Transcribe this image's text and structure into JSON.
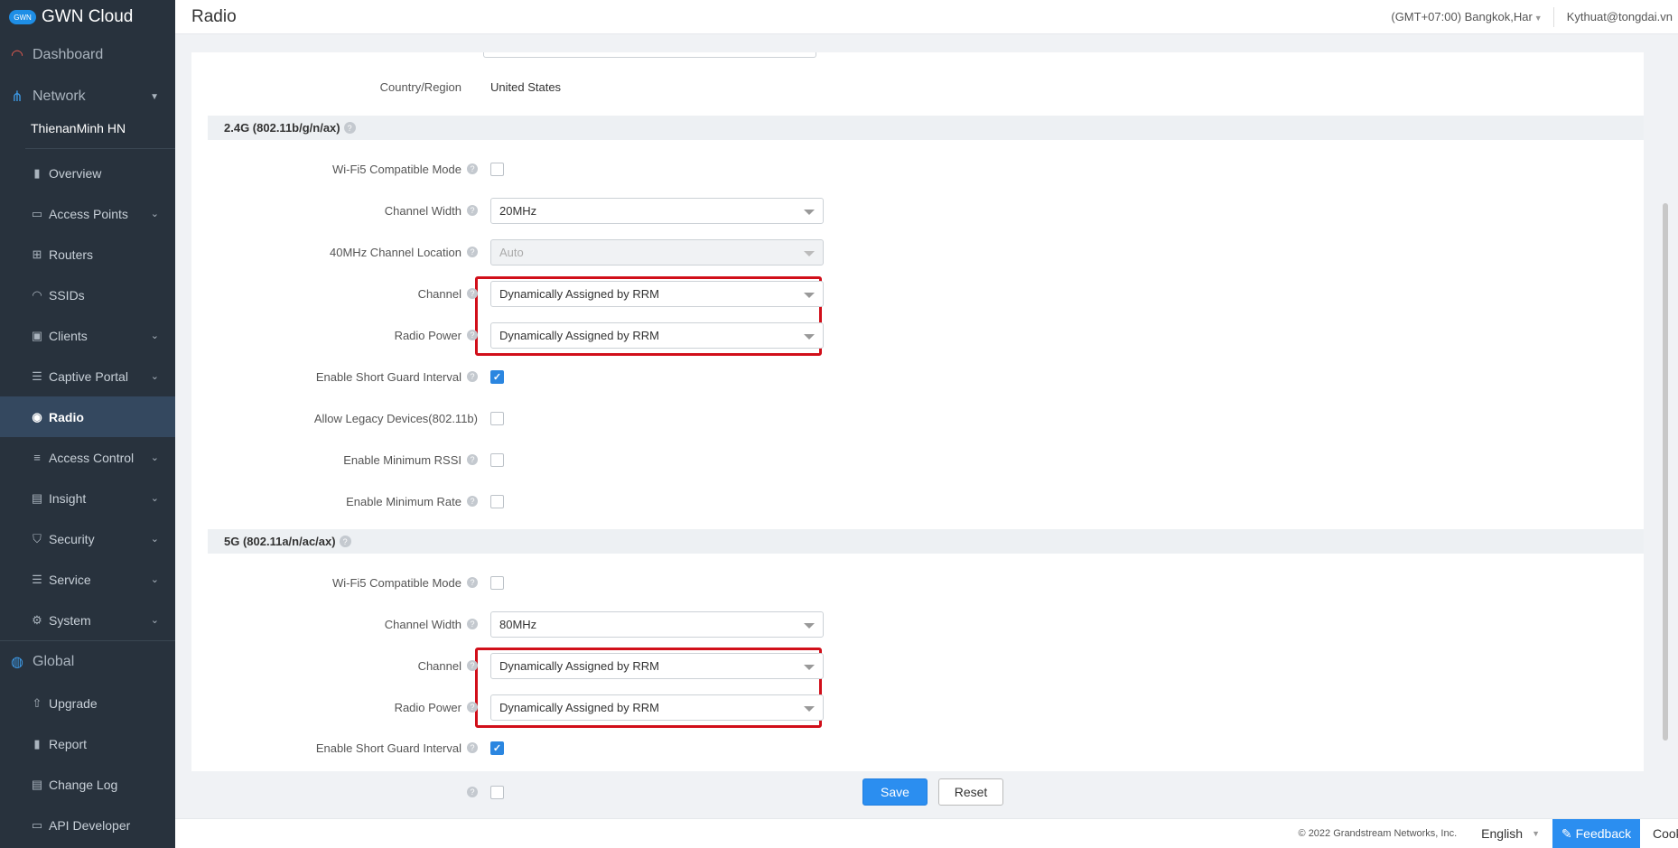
{
  "app": {
    "name": "GWN Cloud",
    "logo_text": "GWN"
  },
  "header": {
    "title": "Radio",
    "timezone": "(GMT+07:00) Bangkok,Har",
    "user": "Kythuat@tongdai.vn"
  },
  "sidebar": {
    "dashboard": "Dashboard",
    "network": "Network",
    "network_name": "ThienanMinh HN",
    "items": [
      {
        "label": "Overview",
        "icon": "bar-chart-icon"
      },
      {
        "label": "Access Points",
        "icon": "access-point-icon"
      },
      {
        "label": "Routers",
        "icon": "router-icon"
      },
      {
        "label": "SSIDs",
        "icon": "wifi-icon"
      },
      {
        "label": "Clients",
        "icon": "clients-icon"
      },
      {
        "label": "Captive Portal",
        "icon": "list-icon"
      },
      {
        "label": "Radio",
        "icon": "radio-icon"
      },
      {
        "label": "Access Control",
        "icon": "sliders-icon"
      },
      {
        "label": "Insight",
        "icon": "insight-icon"
      },
      {
        "label": "Security",
        "icon": "shield-icon"
      },
      {
        "label": "Service",
        "icon": "menu-icon"
      },
      {
        "label": "System",
        "icon": "gear-icon"
      }
    ],
    "global": "Global",
    "global_items": [
      {
        "label": "Upgrade",
        "icon": "upgrade-icon"
      },
      {
        "label": "Report",
        "icon": "report-icon"
      },
      {
        "label": "Change Log",
        "icon": "changelog-icon"
      },
      {
        "label": "API Developer",
        "icon": "api-icon"
      }
    ]
  },
  "form": {
    "country_label": "Country/Region",
    "country_value": "United States",
    "band24": {
      "title": "2.4G (802.11b/g/n/ax)",
      "wifi5_label": "Wi-Fi5 Compatible Mode",
      "wifi5_checked": false,
      "width_label": "Channel Width",
      "width_value": "20MHz",
      "location_label": "40MHz Channel Location",
      "location_value": "Auto",
      "channel_label": "Channel",
      "channel_value": "Dynamically Assigned by RRM",
      "power_label": "Radio Power",
      "power_value": "Dynamically Assigned by RRM",
      "sgi_label": "Enable Short Guard Interval",
      "sgi_checked": true,
      "legacy_label": "Allow Legacy Devices(802.11b)",
      "legacy_checked": false,
      "rssi_label": "Enable Minimum RSSI",
      "rssi_checked": false,
      "rate_label": "Enable Minimum Rate",
      "rate_checked": false
    },
    "band5": {
      "title": "5G (802.11a/n/ac/ax)",
      "wifi5_label": "Wi-Fi5 Compatible Mode",
      "wifi5_checked": false,
      "width_label": "Channel Width",
      "width_value": "80MHz",
      "channel_label": "Channel",
      "channel_value": "Dynamically Assigned by RRM",
      "power_label": "Radio Power",
      "power_value": "Dynamically Assigned by RRM",
      "sgi_label": "Enable Short Guard Interval",
      "sgi_checked": true
    }
  },
  "actions": {
    "save": "Save",
    "reset": "Reset"
  },
  "footer": {
    "copyright": "© 2022 Grandstream Networks, Inc.",
    "language": "English",
    "feedback": "Feedback",
    "cookie": "Cookie"
  },
  "colors": {
    "sidebar_bg": "#28323d",
    "accent": "#2b8ef0",
    "highlight": "#d10f1a"
  }
}
